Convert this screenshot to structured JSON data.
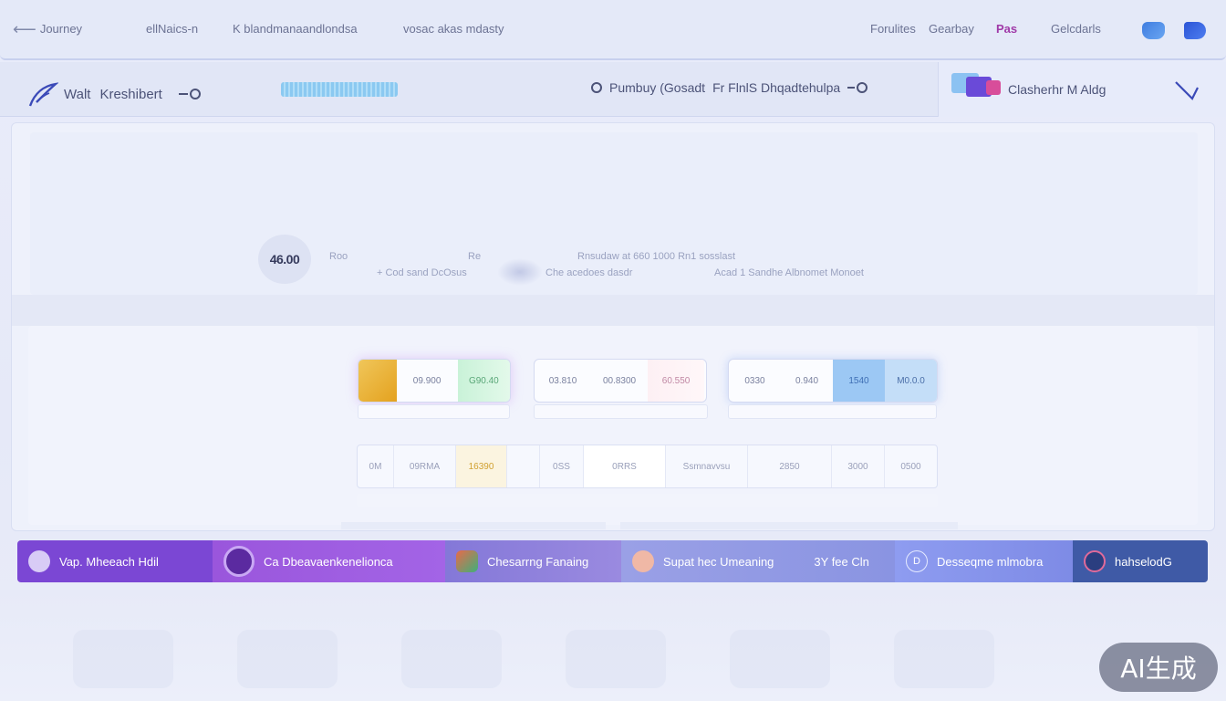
{
  "topbar": {
    "back_label": "Journey",
    "nav": [
      "ellNaics-n",
      "K blandmanaandlondsa",
      "vosac akas mdasty"
    ],
    "right": [
      "Forulites",
      "Gearbay",
      "Pas",
      "Gelcdarls"
    ],
    "icons": [
      "cloud-icon",
      "chat-icon"
    ]
  },
  "secondbar": {
    "brand_first": "Walt",
    "brand_second": "Kreshibert",
    "mid_text": "Pumbuy (Gosadt",
    "mid_text2": "Fr FlnlS Dhqadtehulpa",
    "right_label": "Clasherhr M Aldg"
  },
  "panel": {
    "badge_value": "46.00",
    "faint_texts": [
      "Roo",
      "+ Cod sand DcOsus",
      "Re",
      "Che acedoes dasdr",
      "Rnsudaw at 660 1000 Rn1 sosslast",
      "Acad 1 Sandhe Albnomet Monoet"
    ]
  },
  "cards": [
    {
      "cells": [
        "09.900",
        "G90.40"
      ]
    },
    {
      "cells": [
        "03.810",
        "00.8300",
        "60.550"
      ]
    },
    {
      "cells": [
        "0330",
        "0.940",
        "1540",
        "M0.0.0"
      ]
    }
  ],
  "table_row": [
    "0M",
    "09RMA",
    "16390",
    "",
    "0SS",
    "0RRS",
    "Ssmnavvsu",
    "2850",
    "3000",
    "0500"
  ],
  "tabs": [
    {
      "label": "Vap. Mheeach Hdil",
      "icon": ""
    },
    {
      "label": "Ca Dbeavaenkenelionca",
      "icon": ""
    },
    {
      "label": "Chesarrng Fanaing",
      "icon": ""
    },
    {
      "label": "Supat hec Umeaning",
      "extra": "3Y fee Cln",
      "icon": ""
    },
    {
      "label": "Desseqme mlmobra",
      "icon": "D"
    },
    {
      "label": "hahselodG",
      "icon": ""
    }
  ],
  "watermark": "AI生成",
  "colors": {
    "accent_purple": "#7b47d4",
    "accent_blue": "#3f5aa6",
    "background": "#e9ecfa"
  }
}
